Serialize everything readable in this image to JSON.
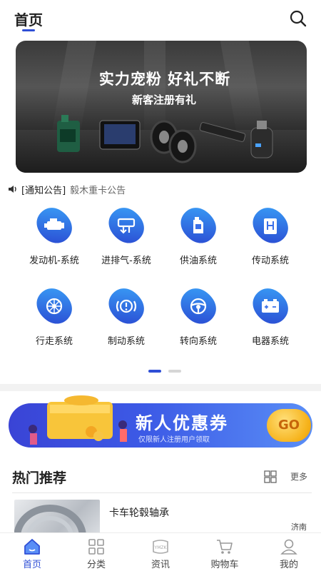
{
  "header": {
    "title": "首页",
    "search_icon": "search-icon"
  },
  "banner": {
    "headline": "实力宠粉   好礼不断",
    "subline": "新客注册有礼"
  },
  "notice": {
    "tag": "[通知公告]",
    "text": "毅木重卡公告"
  },
  "categories": [
    {
      "label": "发动机-系统",
      "icon": "engine-icon"
    },
    {
      "label": "进排气-系统",
      "icon": "intake-exhaust-icon"
    },
    {
      "label": "供油系统",
      "icon": "fuel-icon"
    },
    {
      "label": "传动系统",
      "icon": "transmission-icon"
    },
    {
      "label": "行走系统",
      "icon": "wheel-icon"
    },
    {
      "label": "制动系统",
      "icon": "brake-icon"
    },
    {
      "label": "转向系统",
      "icon": "steering-icon"
    },
    {
      "label": "电器系统",
      "icon": "battery-icon"
    }
  ],
  "pager": {
    "pages": 2,
    "current": 1
  },
  "coupon": {
    "title": "新人优惠券",
    "subtitle": "仅限新人注册用户领取",
    "go": "GO"
  },
  "hot": {
    "title": "热门推荐",
    "more": "更多",
    "items": [
      {
        "name": "卡车轮毂轴承",
        "city": "济南"
      }
    ]
  },
  "tabbar": [
    {
      "label": "首页",
      "icon": "home-icon",
      "active": true
    },
    {
      "label": "分类",
      "icon": "category-icon",
      "active": false
    },
    {
      "label": "资讯",
      "icon": "news-icon",
      "active": false
    },
    {
      "label": "购物车",
      "icon": "cart-icon",
      "active": false
    },
    {
      "label": "我的",
      "icon": "profile-icon",
      "active": false
    }
  ],
  "colors": {
    "accent": "#2f4fd6",
    "coupon_start": "#3a44d6",
    "coupon_end": "#5a8ef6",
    "go": "#f6b21a"
  }
}
